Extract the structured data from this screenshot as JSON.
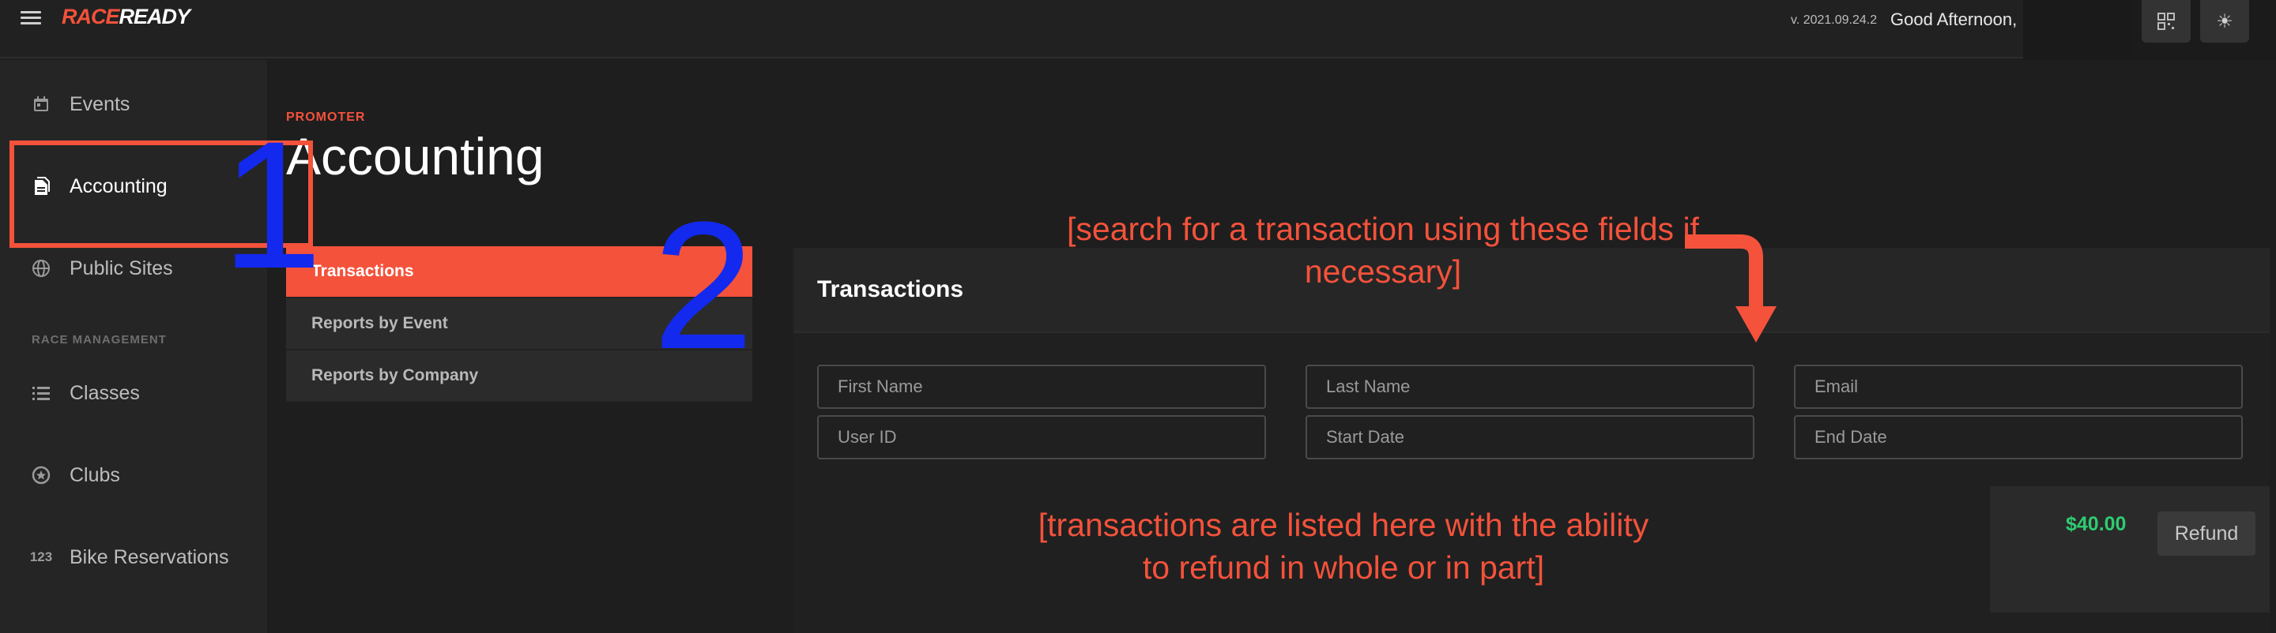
{
  "topbar": {
    "logo_part1": "RACE",
    "logo_part2": "READY",
    "version": "v. 2021.09.24.2",
    "greeting": "Good Afternoon,",
    "icons": [
      "menu-icon",
      "qr-code-icon",
      "sun-icon"
    ]
  },
  "sidebar": {
    "items": [
      {
        "label": "Events",
        "icon": "calendar-icon"
      },
      {
        "label": "Accounting",
        "icon": "document-icon"
      },
      {
        "label": "Public Sites",
        "icon": "globe-icon"
      },
      {
        "label": "Classes",
        "icon": "list-icon"
      },
      {
        "label": "Clubs",
        "icon": "star-circle-icon"
      },
      {
        "label": "Bike Reservations",
        "icon": "numbers-icon",
        "icon_text": "123"
      }
    ],
    "section_label": "RACE MANAGEMENT",
    "active": "Accounting"
  },
  "main": {
    "breadcrumb": "PROMOTER",
    "title": "Accounting",
    "submenu": [
      "Transactions",
      "Reports by Event",
      "Reports by Company"
    ],
    "active_submenu": "Transactions"
  },
  "panel": {
    "title": "Transactions",
    "fields": {
      "first_name": "First Name",
      "last_name": "Last Name",
      "email": "Email",
      "user_id": "User ID",
      "start_date": "Start Date",
      "end_date": "End Date"
    },
    "transaction": {
      "amount": "$40.00",
      "refund_label": "Refund"
    }
  },
  "annotations": {
    "step1": "1",
    "step2": "2",
    "search_note": "[search for a transaction using these fields if necessary]",
    "list_note": "[transactions are listed here with the ability to refund in whole or in part]",
    "color": "#f4523b",
    "number_color": "#1329ee"
  },
  "colors": {
    "accent": "#f4523b",
    "amount": "#2ecc71",
    "background": "#1e1e1e"
  }
}
